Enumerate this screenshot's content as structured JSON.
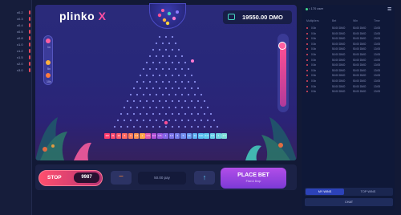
{
  "game": {
    "logo_main": "plinko",
    "logo_x": "X",
    "balance": "19550.00 DMO"
  },
  "left_rail": {
    "rows": [
      "x0.2",
      "x0.3",
      "x0.4",
      "x0.5",
      "x0.8",
      "x1.0",
      "x1.2",
      "x1.5",
      "x2.0",
      "x3.0"
    ]
  },
  "side_labels": {
    "left_top": "1x",
    "left_mid": "5x",
    "left_bottom": "10x",
    "right_top": "Turbo"
  },
  "multipliers": {
    "values": [
      "110",
      "41",
      "10",
      "5",
      "3",
      "1.5",
      "1",
      "0.5",
      "0.3",
      "0.5",
      "1",
      "1.5",
      "3",
      "5",
      "10",
      "41",
      "110",
      "0.3",
      "0.5",
      "1",
      "1.5"
    ],
    "colors": [
      "#ff3b6b",
      "#ff4a6e",
      "#ff5a6a",
      "#ff6a62",
      "#ff7d59",
      "#ff9250",
      "#ffa548",
      "#e45ab0",
      "#b24fd6",
      "#9a58e0",
      "#8566e8",
      "#7a72ea",
      "#7880ee",
      "#738ff0",
      "#6aa0f2",
      "#5fb3f3",
      "#59c0f2",
      "#5fc9ef",
      "#67d0ea",
      "#71d6e2",
      "#7cdcd8"
    ]
  },
  "controls": {
    "stop_label": "STOP",
    "count": "9987",
    "minus_label": "−",
    "amount": "50.00 pay",
    "plus_label": "↑",
    "place_bet_label": "PLACE BET",
    "place_bet_sub": "Find & Drop"
  },
  "panel": {
    "online": "• 170 user",
    "menu_icon": "≡",
    "headers": [
      "Multipliers",
      "Bet",
      "Win",
      "Time"
    ],
    "rows": [
      [
        "0.5x",
        "50.00 DMO",
        "50.00 DMO",
        "13:05"
      ],
      [
        "0.5x",
        "50.00 DMO",
        "50.00 DMO",
        "13:05"
      ],
      [
        "0.5x",
        "50.00 DMO",
        "50.00 DMO",
        "13:05"
      ],
      [
        "0.5x",
        "50.00 DMO",
        "50.00 DMO",
        "13:05"
      ],
      [
        "0.5x",
        "50.00 DMO",
        "50.00 DMO",
        "13:05"
      ],
      [
        "0.5x",
        "50.00 DMO",
        "50.00 DMO",
        "13:05"
      ],
      [
        "0.5x",
        "50.00 DMO",
        "50.00 DMO",
        "13:05"
      ],
      [
        "0.5x",
        "50.00 DMO",
        "50.00 DMO",
        "13:05"
      ],
      [
        "0.5x",
        "50.00 DMO",
        "50.00 DMO",
        "13:05"
      ],
      [
        "0.5x",
        "50.00 DMO",
        "50.00 DMO",
        "13:05"
      ],
      [
        "0.5x",
        "50.00 DMO",
        "50.00 DMO",
        "13:05"
      ],
      [
        "0.5x",
        "50.00 DMO",
        "50.00 DMO",
        "13:05"
      ],
      [
        "0.5x",
        "50.00 DMO",
        "50.00 DMO",
        "13:05"
      ]
    ],
    "tab_my": "MY WINS",
    "tab_top": "TOP WINS",
    "chat": "CHAT"
  }
}
